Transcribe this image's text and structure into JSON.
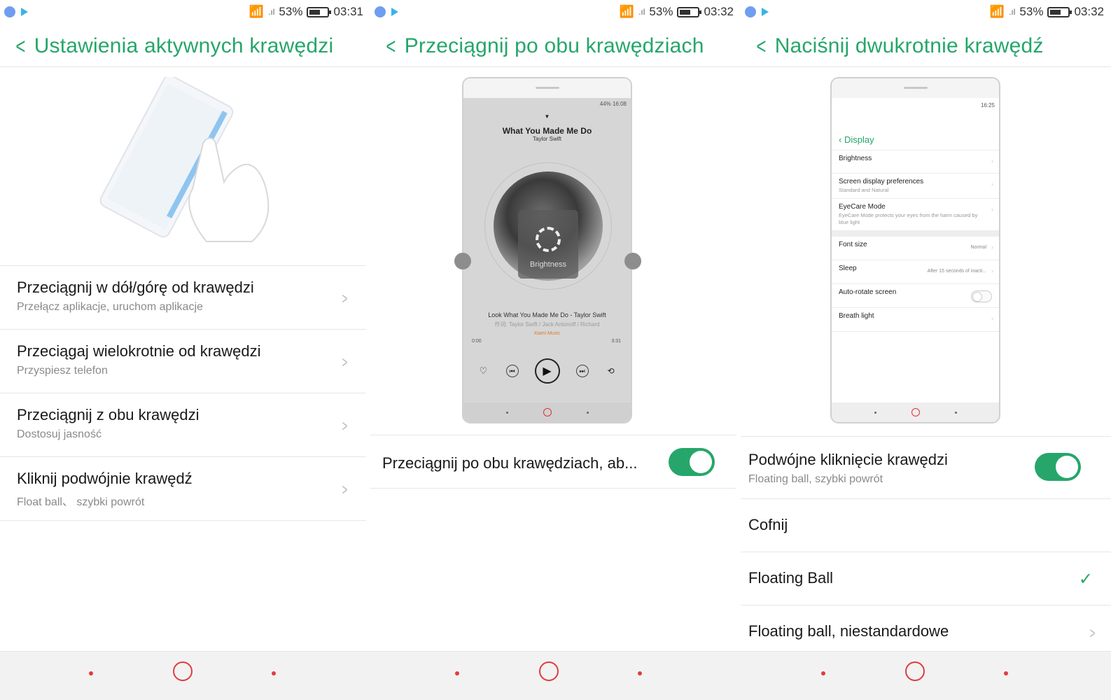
{
  "panels": [
    {
      "status": {
        "battery_pct": "53%",
        "time": "03:31"
      },
      "title": "Ustawienia aktywnych krawędzi",
      "items": [
        {
          "title": "Przeciągnij w dół/górę od krawędzi",
          "subtitle": "Przełącz aplikacje, uruchom aplikacje"
        },
        {
          "title": "Przeciągaj wielokrotnie od krawędzi",
          "subtitle": "Przyspiesz telefon"
        },
        {
          "title": "Przeciągnij z obu krawędzi",
          "subtitle": "Dostosuj jasność"
        },
        {
          "title": "Kliknij podwójnie krawędź",
          "subtitle": "Float ball、 szybki powrót"
        }
      ]
    },
    {
      "status": {
        "battery_pct": "53%",
        "time": "03:32"
      },
      "title": "Przeciągnij po obu krawędziach",
      "preview": {
        "mini_status": "44%  16:08",
        "song_title": "What You Made Me Do",
        "song_artist": "Taylor Swift",
        "overlay_label": "Brightness",
        "song_line": "Look What You Made Me Do - Taylor Swift",
        "lyric_line": "作词: Taylor Swift / Jack Antonoff / Richard",
        "source": "Xiami Music",
        "time_start": "0:00",
        "time_end": "3:31"
      },
      "setting": {
        "label": "Przeciągnij po obu krawędziach, ab...",
        "enabled": true
      }
    },
    {
      "status": {
        "battery_pct": "53%",
        "time": "03:32"
      },
      "title": "Naciśnij dwukrotnie krawędź",
      "preview": {
        "mini_status": "16:25",
        "back_label": "Display",
        "rows": {
          "brightness": "Brightness",
          "screen_display": "Screen display preferences",
          "screen_display_sub": "Standard and Natural",
          "eyecare": "EyeCare Mode",
          "eyecare_sub": "EyeCare Mode protects your eyes from the harm caused by blue light",
          "font_size": "Font size",
          "font_size_val": "Normal",
          "sleep": "Sleep",
          "sleep_val": "After 15 seconds of inacti...",
          "auto_rotate": "Auto-rotate screen",
          "breath_light": "Breath light"
        }
      },
      "setting": {
        "title": "Podwójne kliknięcie krawędzi",
        "subtitle": "Floating ball, szybki powrót",
        "enabled": true
      },
      "options": [
        {
          "label": "Cofnij",
          "selected": false
        },
        {
          "label": "Floating Ball",
          "selected": true
        },
        {
          "label": "Floating ball, niestandardowe",
          "selected": false
        }
      ]
    }
  ],
  "colors": {
    "accent": "#26a66a",
    "nav_accent": "#e23c3c"
  }
}
